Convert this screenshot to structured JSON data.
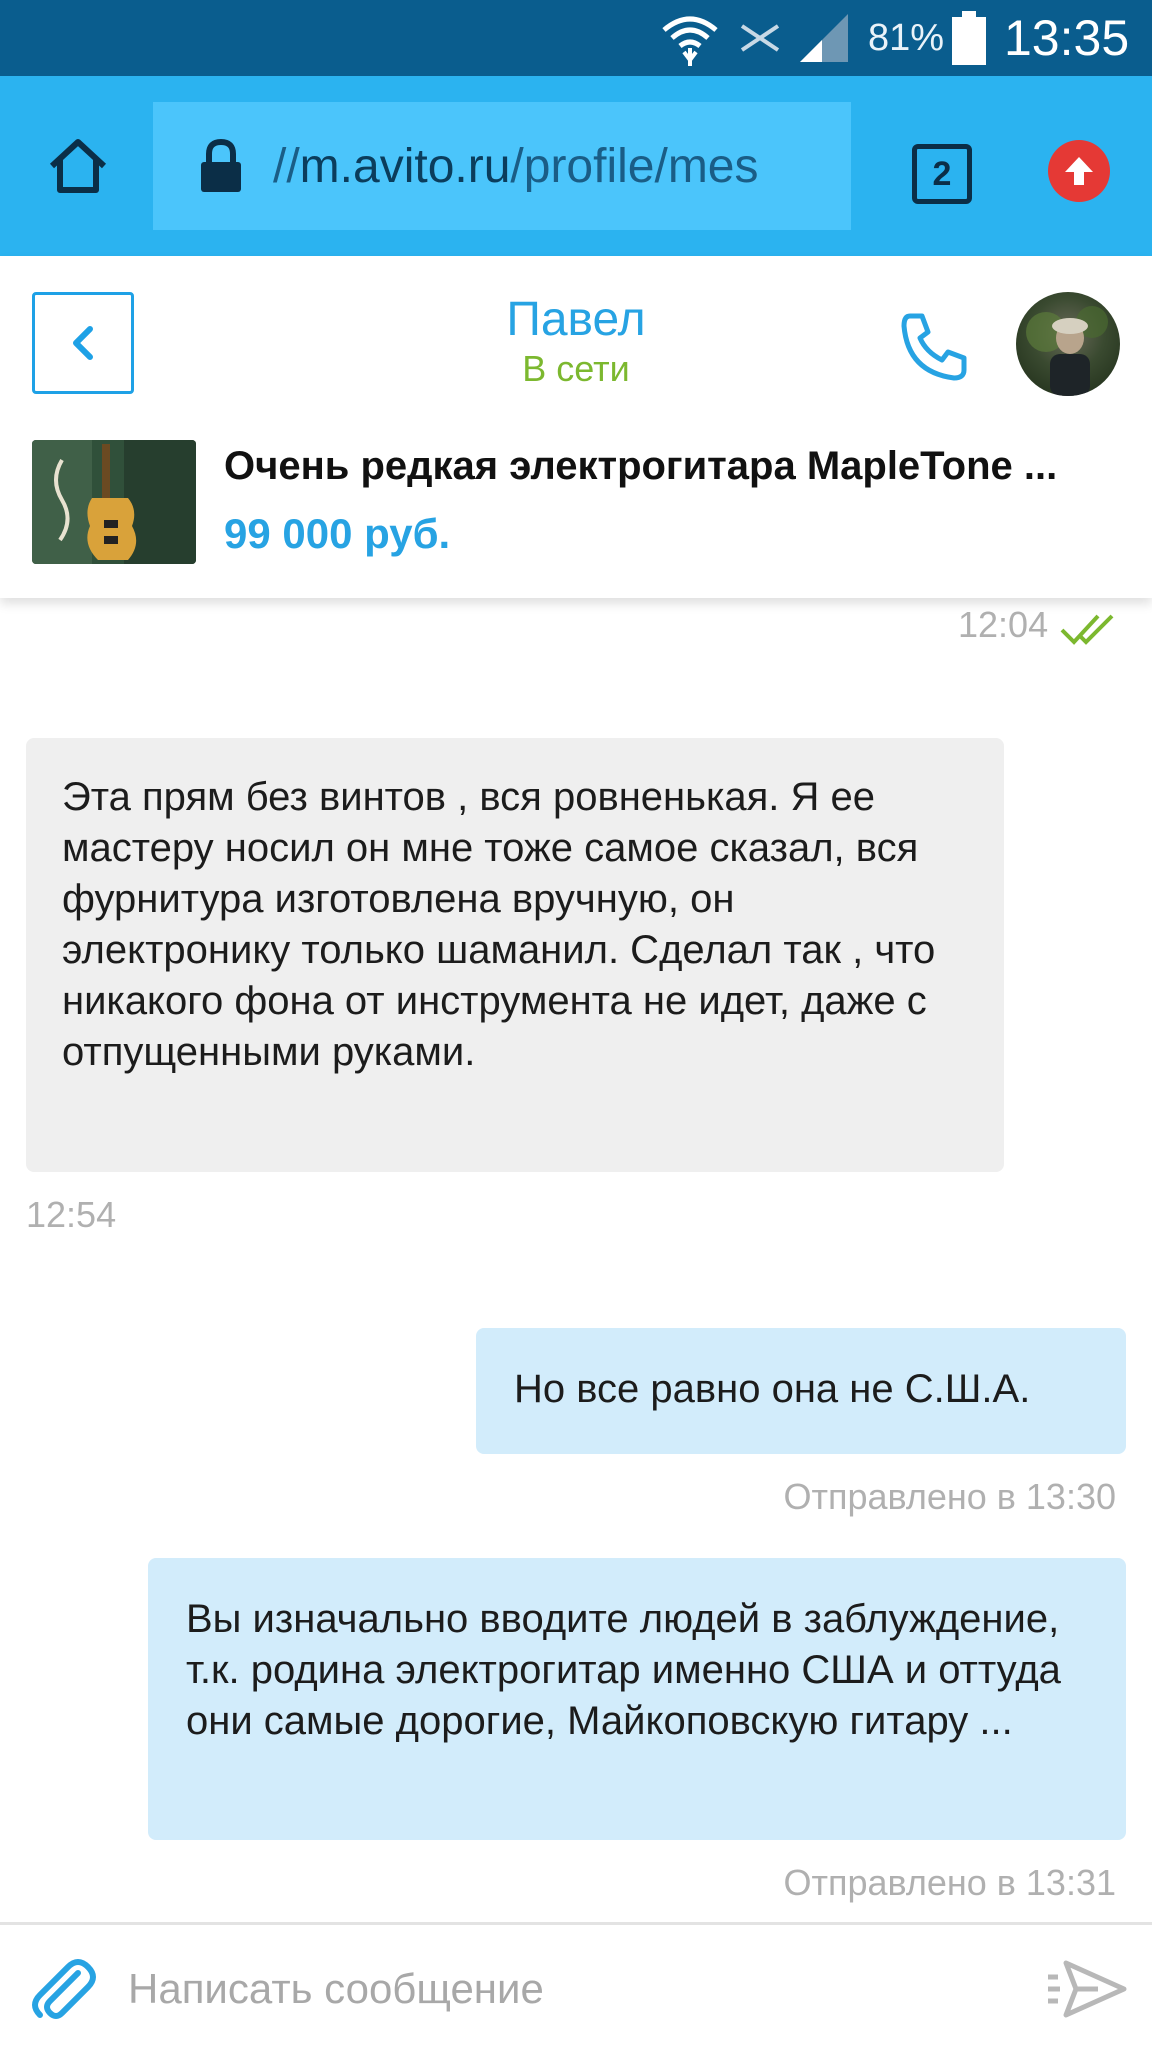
{
  "status_bar": {
    "battery_percent": "81%",
    "time": "13:35"
  },
  "browser": {
    "url_prefix": "//",
    "url_domain": "m.avito.ru",
    "url_path": "/profile/mes",
    "tab_count": "2"
  },
  "chat_header": {
    "contact_name": "Павел",
    "contact_status": "В сети",
    "ad_title": "Очень редкая электрогитара MapleTone ...",
    "ad_price": "99 000 руб."
  },
  "messages": [
    {
      "direction": "out",
      "time": "12:04",
      "status": "read"
    },
    {
      "direction": "in",
      "text": "Эта прям без винтов , вся ровненькая. Я ее мастеру носил он мне тоже самое сказал, вся фурнитура изготовлена вручную, он электронику только шаманил. Сделал так , что никакого фона от инструмента не идет, даже с отпущенными руками.",
      "time": "12:54"
    },
    {
      "direction": "out",
      "text": "Но все равно она не С.Ш.А.",
      "time": "Отправлено в 13:30"
    },
    {
      "direction": "out",
      "text": "Вы изначально вводите людей в заблуждение, т.к. родина электрогитар именно США и оттуда они самые дорогие, Майкоповскую гитару ...",
      "time": "Отправлено в 13:31"
    }
  ],
  "composer": {
    "placeholder": "Написать сообщение"
  },
  "colors": {
    "status_bar": "#0a5d8e",
    "browser_bar": "#2bb3f0",
    "accent": "#27a3e3",
    "online": "#7cb82f",
    "incoming_bubble": "#efefef",
    "outgoing_bubble": "#d2ecfb",
    "read_check": "#7cb82f",
    "update_badge": "#e53935"
  },
  "icons": [
    "wifi-icon",
    "no-sim-icon",
    "signal-icon",
    "battery-icon",
    "home-icon",
    "lock-icon",
    "tabs-icon",
    "update-icon",
    "back-icon",
    "phone-icon",
    "double-check-icon",
    "attach-icon",
    "send-icon"
  ]
}
